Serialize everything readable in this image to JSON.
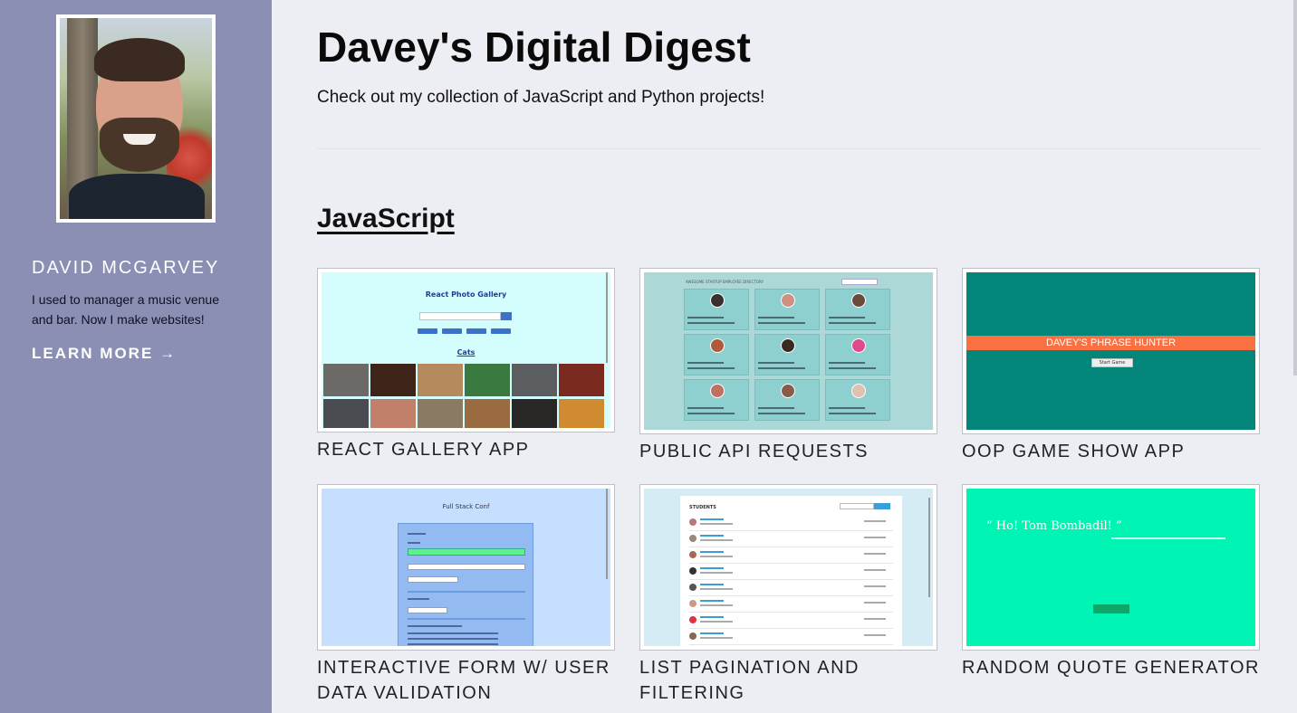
{
  "sidebar": {
    "name": "DAVID MCGARVEY",
    "bio": "I used to manager a music venue and bar. Now I make websites!",
    "learn_more": "LEARN MORE →"
  },
  "header": {
    "title": "Davey's Digital Digest",
    "tagline": "Check out my collection of JavaScript and Python projects!"
  },
  "section": {
    "title": "JavaScript"
  },
  "projects": [
    {
      "title": "REACT GALLERY APP"
    },
    {
      "title": "PUBLIC API REQUESTS"
    },
    {
      "title": "OOP GAME SHOW APP"
    },
    {
      "title": "INTERACTIVE FORM W/ USER DATA VALIDATION"
    },
    {
      "title": "LIST PAGINATION AND FILTERING"
    },
    {
      "title": "RANDOM QUOTE GENERATOR"
    }
  ],
  "thumbnails": {
    "gallery_title": "React Photo Gallery",
    "gallery_cats": "Cats",
    "game_banner": "DAVEY'S PHRASE HUNTER",
    "game_button": "Start Game",
    "form_subtitle": "Full Stack Conf",
    "list_title": "STUDENTS",
    "quote_text": "“ Ho! Tom Bombadil! ”"
  },
  "colors": {
    "sidebar_bg": "#8b8fb4",
    "page_bg": "#edeef3"
  }
}
